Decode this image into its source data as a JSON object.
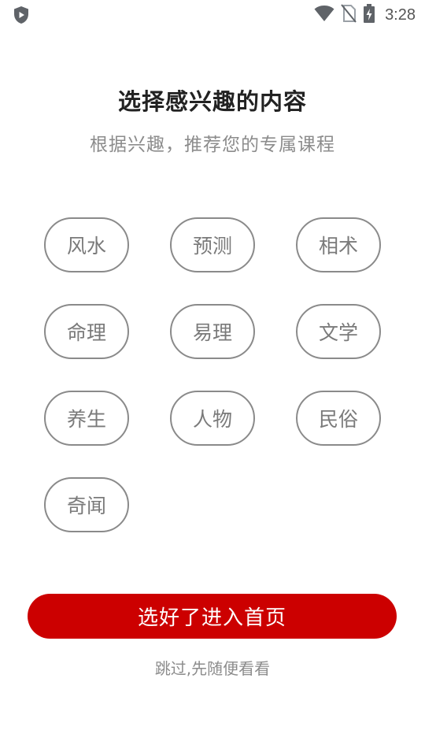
{
  "status_bar": {
    "time": "3:28",
    "icons": [
      "shield-icon",
      "wifi-icon",
      "no-sim-icon",
      "battery-charging-icon"
    ]
  },
  "header": {
    "title": "选择感兴趣的内容",
    "subtitle": "根据兴趣，推荐您的专属课程"
  },
  "tags": [
    {
      "label": "风水",
      "selected": false
    },
    {
      "label": "预测",
      "selected": false
    },
    {
      "label": "相术",
      "selected": false
    },
    {
      "label": "命理",
      "selected": false
    },
    {
      "label": "易理",
      "selected": false
    },
    {
      "label": "文学",
      "selected": false
    },
    {
      "label": "养生",
      "selected": false
    },
    {
      "label": "人物",
      "selected": false
    },
    {
      "label": "民俗",
      "selected": false
    },
    {
      "label": "奇闻",
      "selected": false
    }
  ],
  "actions": {
    "confirm_label": "选好了进入首页",
    "skip_label": "跳过,先随便看看"
  },
  "colors": {
    "accent": "#cc0000",
    "tag_border": "#8a8a8a",
    "tag_text": "#7a7a7a",
    "title_text": "#222222",
    "muted_text": "#8c8c8c"
  }
}
